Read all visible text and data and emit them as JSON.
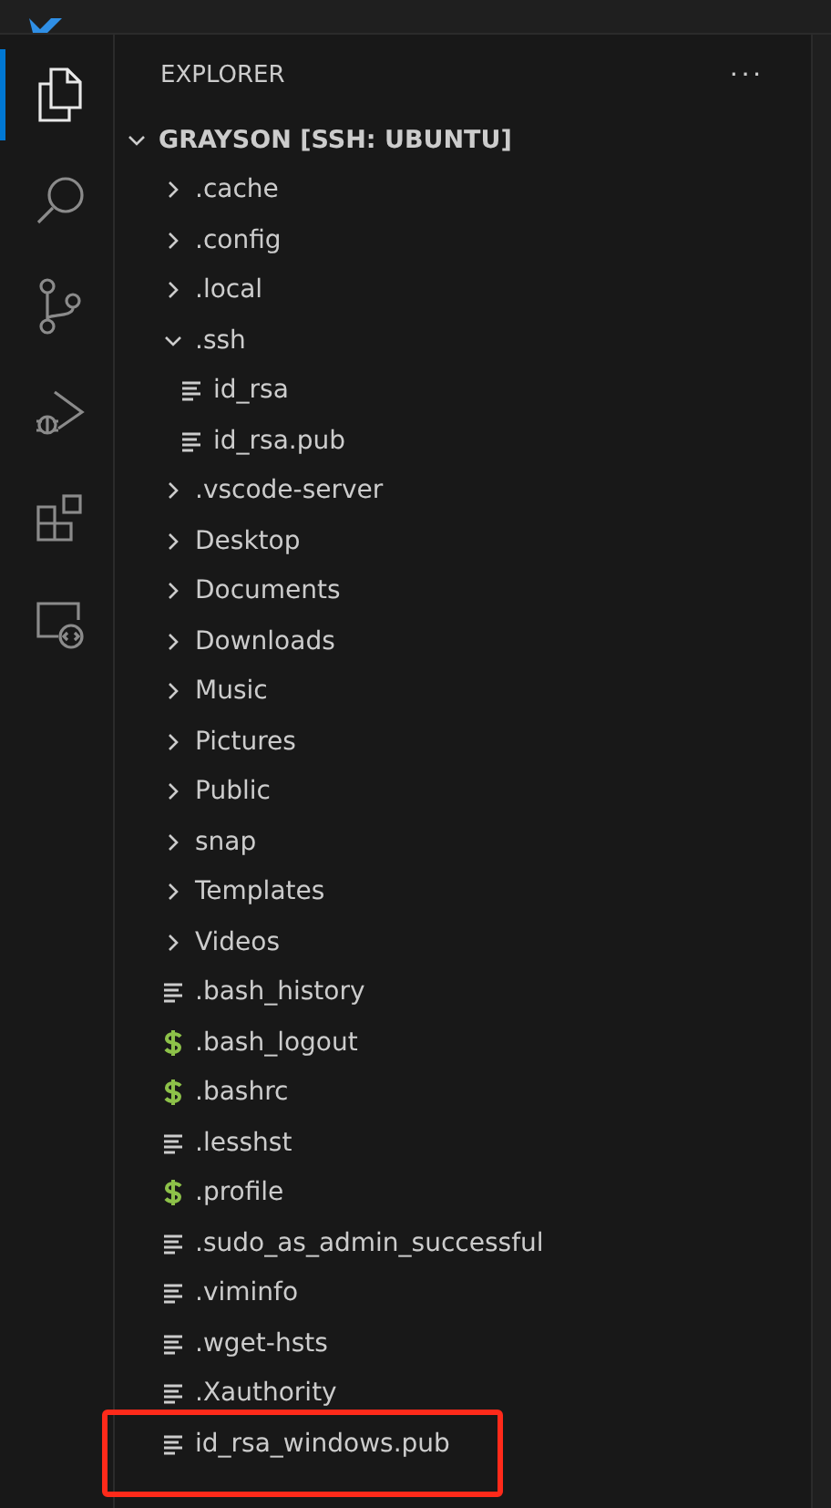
{
  "activity_bar": [
    {
      "kind": "files",
      "selected": true
    },
    {
      "kind": "search",
      "selected": false
    },
    {
      "kind": "source-control",
      "selected": false
    },
    {
      "kind": "run-debug",
      "selected": false
    },
    {
      "kind": "extensions",
      "selected": false
    },
    {
      "kind": "remote",
      "selected": false
    }
  ],
  "explorer": {
    "title": "EXPLORER",
    "more": "···",
    "root": {
      "label": "GRAYSON [SSH: UBUNTU]",
      "expanded": true,
      "children": [
        {
          "label": ".cache",
          "kind": "folder",
          "expanded": false
        },
        {
          "label": ".config",
          "kind": "folder",
          "expanded": false
        },
        {
          "label": ".local",
          "kind": "folder",
          "expanded": false
        },
        {
          "label": ".ssh",
          "kind": "folder",
          "expanded": true,
          "children": [
            {
              "label": "id_rsa",
              "kind": "text",
              "highlighted": false
            },
            {
              "label": "id_rsa.pub",
              "kind": "text",
              "highlighted": false
            }
          ]
        },
        {
          "label": ".vscode-server",
          "kind": "folder",
          "expanded": false
        },
        {
          "label": "Desktop",
          "kind": "folder",
          "expanded": false
        },
        {
          "label": "Documents",
          "kind": "folder",
          "expanded": false
        },
        {
          "label": "Downloads",
          "kind": "folder",
          "expanded": false
        },
        {
          "label": "Music",
          "kind": "folder",
          "expanded": false
        },
        {
          "label": "Pictures",
          "kind": "folder",
          "expanded": false
        },
        {
          "label": "Public",
          "kind": "folder",
          "expanded": false
        },
        {
          "label": "snap",
          "kind": "folder",
          "expanded": false
        },
        {
          "label": "Templates",
          "kind": "folder",
          "expanded": false
        },
        {
          "label": "Videos",
          "kind": "folder",
          "expanded": false
        },
        {
          "label": ".bash_history",
          "kind": "text",
          "highlighted": false
        },
        {
          "label": ".bash_logout",
          "kind": "shell",
          "highlighted": false
        },
        {
          "label": ".bashrc",
          "kind": "shell",
          "highlighted": false
        },
        {
          "label": ".lesshst",
          "kind": "text",
          "highlighted": false
        },
        {
          "label": ".profile",
          "kind": "shell",
          "highlighted": false
        },
        {
          "label": ".sudo_as_admin_successful",
          "kind": "text",
          "highlighted": false
        },
        {
          "label": ".viminfo",
          "kind": "text",
          "highlighted": false
        },
        {
          "label": ".wget-hsts",
          "kind": "text",
          "highlighted": false
        },
        {
          "label": ".Xauthority",
          "kind": "text",
          "highlighted": false
        },
        {
          "label": "id_rsa_windows.pub",
          "kind": "text",
          "highlighted": true
        }
      ]
    }
  }
}
